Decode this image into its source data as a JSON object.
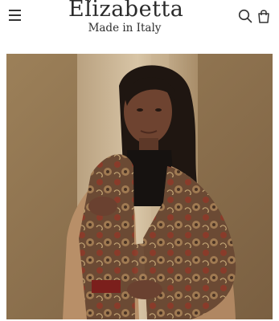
{
  "header": {
    "brand": "Elizabetta",
    "tagline": "Made in Italy",
    "menu_icon": "hamburger-menu-icon",
    "search_icon": "search-icon",
    "cart_icon": "shopping-bag-icon"
  },
  "hero": {
    "subject": "model-wearing-paisley-shawl"
  },
  "colors": {
    "text": "#2b2b2b",
    "background": "#ffffff",
    "backdrop": "#8f7352"
  }
}
